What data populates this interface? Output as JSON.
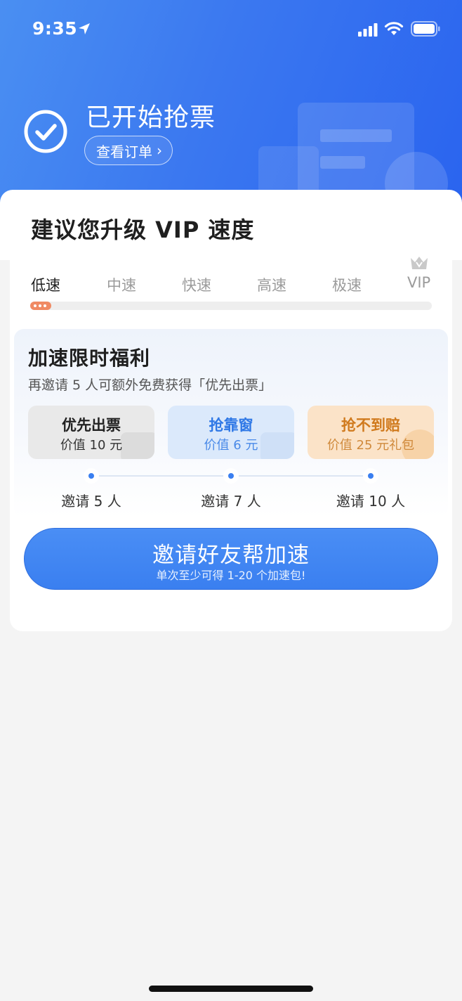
{
  "status_bar": {
    "time": "9:35",
    "icons": [
      "location-arrow-icon",
      "cellular-signal-icon",
      "wifi-icon",
      "battery-icon"
    ]
  },
  "hero": {
    "title": "已开始抢票",
    "order_button": "查看订单",
    "order_chevron": "›",
    "icon": "check-circle-icon"
  },
  "upgrade": {
    "title": "建议您升级 VIP 速度",
    "levels": [
      "低速",
      "中速",
      "快速",
      "高速",
      "极速",
      "VIP"
    ],
    "active_level": "低速",
    "vip_icon": "crown-icon",
    "progress_fraction": 0.05,
    "progress_color": "#f08a63"
  },
  "benefit": {
    "title": "加速限时福利",
    "subtitle": "再邀请 5 人可额外免费获得「优先出票」",
    "rewards": [
      {
        "title": "优先出票",
        "value": "价值 10 元",
        "icon": "lightning-icon"
      },
      {
        "title": "抢靠窗",
        "value": "价值 6 元",
        "icon": "seat-icon"
      },
      {
        "title": "抢不到赔",
        "value": "价值 25 元礼包",
        "icon": "yuan-coin-icon"
      }
    ],
    "steps": [
      "邀请 5 人",
      "邀请 7 人",
      "邀请 10 人"
    ]
  },
  "cta": {
    "title": "邀请好友帮加速",
    "subtitle": "单次至少可得 1-20 个加速包!"
  },
  "colors": {
    "header_blue": "#3b78f0",
    "accent_blue": "#3a7ff0",
    "orange": "#d07a1d"
  }
}
